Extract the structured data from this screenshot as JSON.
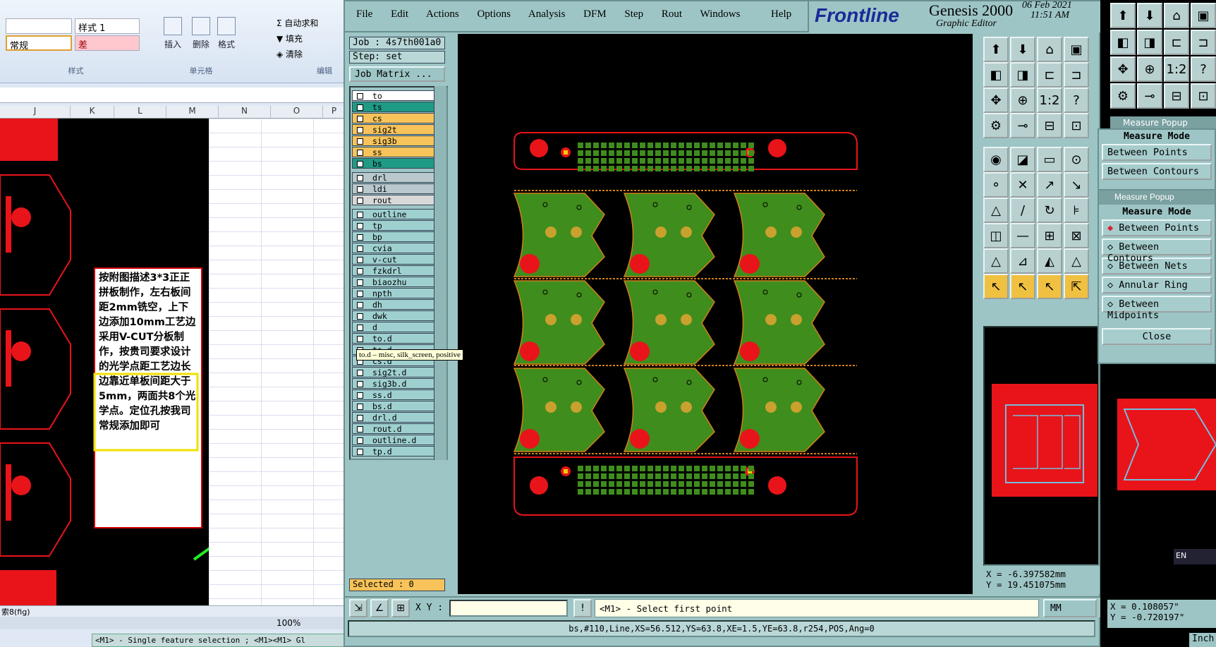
{
  "excel": {
    "style_name": "样式 1",
    "normal": "常规",
    "bad": "差",
    "autosum": "自动求和",
    "fill": "填充",
    "clear": "清除",
    "insert": "插入",
    "delete": "删除",
    "format": "格式",
    "group_styles": "样式",
    "group_cells": "单元格",
    "group_edit": "编辑",
    "columns": [
      "J",
      "K",
      "L",
      "M",
      "N",
      "O",
      "P"
    ],
    "note": "按附图描述3*3正正拼板制作，左右板间距2mm铣空，上下边添加10mm工艺边采用V-CUT分板制作，按贵司要求设计的光学点距工艺边长边靠近单板间距大于5mm，两面共8个光学点。定位孔按我司常规添加即可",
    "sheet_tab": "索8(fig)",
    "zoom": "100%"
  },
  "genesis": {
    "menu": [
      "File",
      "Edit",
      "Actions",
      "Options",
      "Analysis",
      "DFM",
      "Step",
      "Rout",
      "Windows"
    ],
    "help": "Help",
    "brand": "Frontline",
    "product": "Genesis 2000",
    "subtitle": "Graphic Editor",
    "date": "06 Feb 2021",
    "time": "11:51 AM",
    "job": "Job : 4s7th001a0",
    "step": "Step: set",
    "job_matrix": "Job Matrix ...",
    "layers": [
      {
        "name": "to",
        "color": "#ffffff"
      },
      {
        "name": "ts",
        "color": "#1f9a85"
      },
      {
        "name": "cs",
        "color": "#f7c35a"
      },
      {
        "name": "sig2t",
        "color": "#f7c35a"
      },
      {
        "name": "sig3b",
        "color": "#f7c35a"
      },
      {
        "name": "ss",
        "color": "#f7c35a"
      },
      {
        "name": "bs",
        "color": "#1f9a85"
      },
      {
        "name": "drl",
        "color": "#b8c8cc"
      },
      {
        "name": "ldi",
        "color": "#b8c8cc"
      },
      {
        "name": "rout",
        "color": "#d8d8d8"
      },
      {
        "name": "outline",
        "color": "#9fd0d0"
      },
      {
        "name": "tp",
        "color": "#9fd0d0"
      },
      {
        "name": "bp",
        "color": "#9fd0d0"
      },
      {
        "name": "cvia",
        "color": "#9fd0d0"
      },
      {
        "name": "v-cut",
        "color": "#9fd0d0"
      },
      {
        "name": "fzkdrl",
        "color": "#9fd0d0"
      },
      {
        "name": "biaozhu",
        "color": "#9fd0d0"
      },
      {
        "name": "npth",
        "color": "#9fd0d0"
      },
      {
        "name": "dh",
        "color": "#9fd0d0"
      },
      {
        "name": "dwk",
        "color": "#9fd0d0"
      },
      {
        "name": "d",
        "color": "#9fd0d0"
      },
      {
        "name": "to.d",
        "color": "#9fd0d0"
      },
      {
        "name": "ts.d",
        "color": "#9fd0d0"
      },
      {
        "name": "cs.d",
        "color": "#9fd0d0"
      },
      {
        "name": "sig2t.d",
        "color": "#9fd0d0"
      },
      {
        "name": "sig3b.d",
        "color": "#9fd0d0"
      },
      {
        "name": "ss.d",
        "color": "#9fd0d0"
      },
      {
        "name": "bs.d",
        "color": "#9fd0d0"
      },
      {
        "name": "drl.d",
        "color": "#9fd0d0"
      },
      {
        "name": "rout.d",
        "color": "#9fd0d0"
      },
      {
        "name": "outline.d",
        "color": "#9fd0d0"
      },
      {
        "name": "tp.d",
        "color": "#9fd0d0"
      }
    ],
    "tooltip": "to.d – misc, silk_screen, positive",
    "selected": "Selected : 0",
    "xy_label": "X Y :",
    "prompt": "<M1> - Select first point",
    "units": "MM",
    "status_line": "bs,#110,Line,XS=56.512,YS=63.8,XE=1.5,YE=63.8,r254,POS,Ang=0",
    "coord_x": "X = -6.397582mm",
    "coord_y": "Y = 19.451075mm",
    "bottom_hint": "<M1> - Single feature selection ; <M1><M1> Gl"
  },
  "measure": {
    "title": "Measure Popup",
    "mode_label": "Measure Mode",
    "options": [
      "Between Points",
      "Between Contours",
      "Between Nets",
      "Annular Ring",
      "Between Midpoints"
    ],
    "close": "Close"
  },
  "right": {
    "coord_x": "X = 0.108057\"",
    "coord_y": "Y = -0.720197\"",
    "units": "Inch",
    "lang": "EN"
  },
  "colors": {
    "board_red": "#e8141a",
    "copper_green": "#3f8d1c",
    "pad_yellow": "#c9a12e",
    "bg": "#9ec5c5"
  }
}
